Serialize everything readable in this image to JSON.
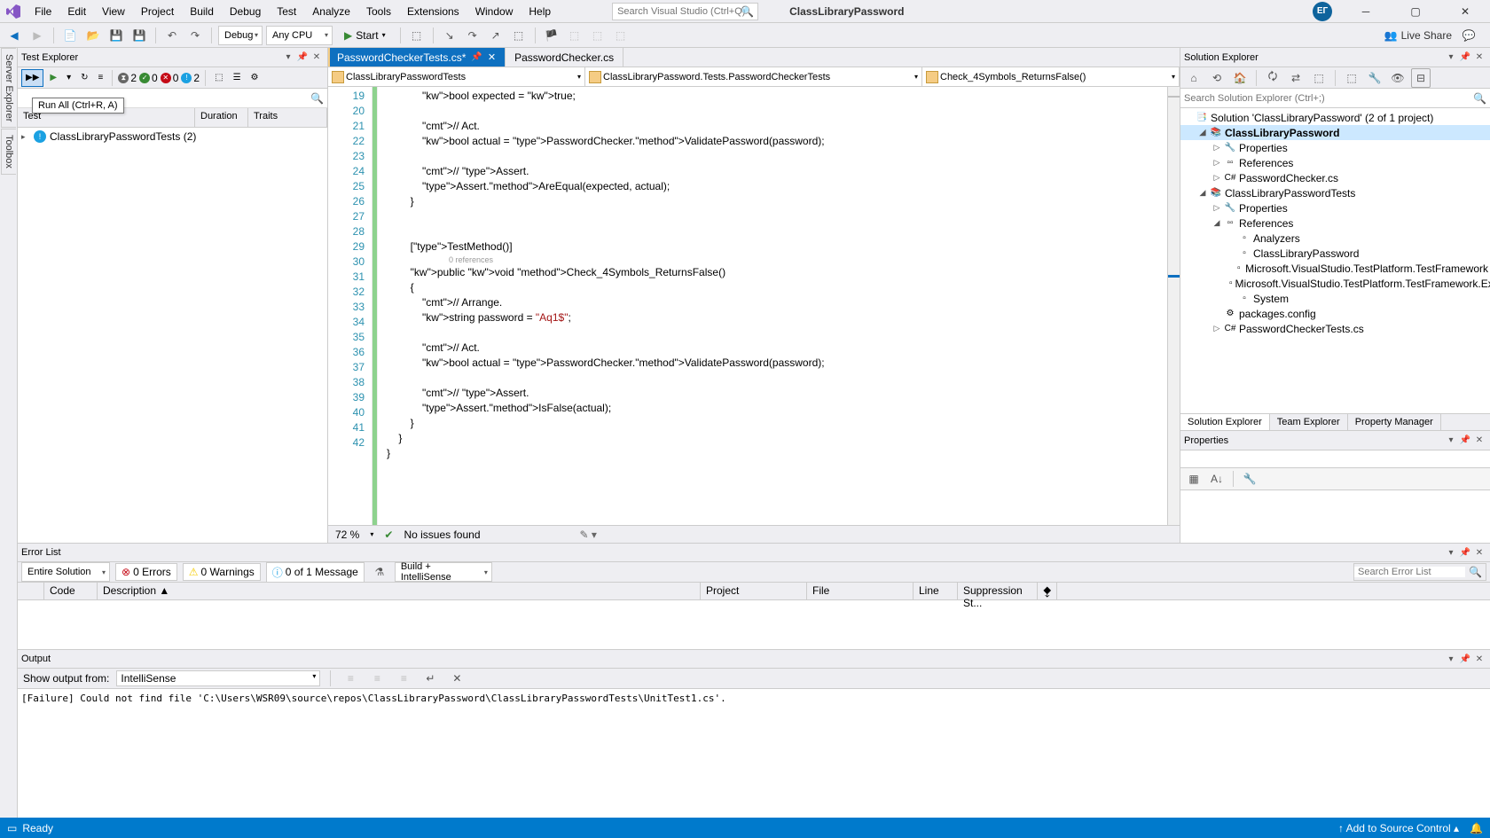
{
  "title_menu": [
    "File",
    "Edit",
    "View",
    "Project",
    "Build",
    "Debug",
    "Test",
    "Analyze",
    "Tools",
    "Extensions",
    "Window",
    "Help"
  ],
  "title_search_placeholder": "Search Visual Studio (Ctrl+Q)",
  "solution_title": "ClassLibraryPassword",
  "user_initials": "ЕГ",
  "toolbar": {
    "config": "Debug",
    "platform": "Any CPU",
    "start": "Start",
    "liveshare": "Live Share"
  },
  "left_rail": [
    "Server Explorer",
    "Toolbox"
  ],
  "test_explorer": {
    "title": "Test Explorer",
    "tooltip": "Run All (Ctrl+R, A)",
    "counts": {
      "total": "2",
      "passed": "0",
      "failed": "0",
      "notrun": "2"
    },
    "columns": [
      "Test",
      "Duration",
      "Traits"
    ],
    "root": "ClassLibraryPasswordTests (2)"
  },
  "editor": {
    "tabs": [
      {
        "name": "PasswordCheckerTests.cs*",
        "active": true
      },
      {
        "name": "PasswordChecker.cs",
        "active": false
      }
    ],
    "nav": [
      "ClassLibraryPasswordTests",
      "ClassLibraryPassword.Tests.PasswordCheckerTests",
      "Check_4Symbols_ReturnsFalse()"
    ],
    "line_start": 19,
    "line_end": 42,
    "zoom": "72 %",
    "issues": "No issues found",
    "references_hint": "0 references"
  },
  "code": [
    {
      "n": 19,
      "t": "            bool expected = true;"
    },
    {
      "n": 20,
      "t": ""
    },
    {
      "n": 21,
      "t": "            // Act."
    },
    {
      "n": 22,
      "t": "            bool actual = PasswordChecker.ValidatePassword(password);"
    },
    {
      "n": 23,
      "t": ""
    },
    {
      "n": 24,
      "t": "            // Assert."
    },
    {
      "n": 25,
      "t": "            Assert.AreEqual(expected, actual);"
    },
    {
      "n": 26,
      "t": "        }"
    },
    {
      "n": 27,
      "t": ""
    },
    {
      "n": 28,
      "t": ""
    },
    {
      "n": 29,
      "t": "        [TestMethod()]"
    },
    {
      "n": 30,
      "t": "        public void Check_4Symbols_ReturnsFalse()"
    },
    {
      "n": 31,
      "t": "        {"
    },
    {
      "n": 32,
      "t": "            // Arrange."
    },
    {
      "n": 33,
      "t": "            string password = \"Aq1$\";"
    },
    {
      "n": 34,
      "t": ""
    },
    {
      "n": 35,
      "t": "            // Act."
    },
    {
      "n": 36,
      "t": "            bool actual = PasswordChecker.ValidatePassword(password);"
    },
    {
      "n": 37,
      "t": ""
    },
    {
      "n": 38,
      "t": "            // Assert."
    },
    {
      "n": 39,
      "t": "            Assert.IsFalse(actual);"
    },
    {
      "n": 40,
      "t": "        }"
    },
    {
      "n": 41,
      "t": "    }"
    },
    {
      "n": 42,
      "t": "}"
    }
  ],
  "solution_explorer": {
    "title": "Solution Explorer",
    "search_placeholder": "Search Solution Explorer (Ctrl+;)",
    "nodes": [
      {
        "depth": 0,
        "icon": "sln",
        "label": "Solution 'ClassLibraryPassword' (2 of 1 project)",
        "exp": "-"
      },
      {
        "depth": 1,
        "icon": "proj",
        "label": "ClassLibraryPassword",
        "exp": "▾",
        "bold": true,
        "selected": true
      },
      {
        "depth": 2,
        "icon": "wrench",
        "label": "Properties",
        "exp": "▸"
      },
      {
        "depth": 2,
        "icon": "refs",
        "label": "References",
        "exp": "▸"
      },
      {
        "depth": 2,
        "icon": "cs",
        "label": "PasswordChecker.cs",
        "exp": "▸"
      },
      {
        "depth": 1,
        "icon": "proj",
        "label": "ClassLibraryPasswordTests",
        "exp": "▾"
      },
      {
        "depth": 2,
        "icon": "wrench",
        "label": "Properties",
        "exp": "▸"
      },
      {
        "depth": 2,
        "icon": "refs",
        "label": "References",
        "exp": "▾"
      },
      {
        "depth": 3,
        "icon": "ref",
        "label": "Analyzers",
        "exp": ""
      },
      {
        "depth": 3,
        "icon": "ref",
        "label": "ClassLibraryPassword",
        "exp": ""
      },
      {
        "depth": 3,
        "icon": "ref",
        "label": "Microsoft.VisualStudio.TestPlatform.TestFramework",
        "exp": ""
      },
      {
        "depth": 3,
        "icon": "ref",
        "label": "Microsoft.VisualStudio.TestPlatform.TestFramework.Extensions",
        "exp": ""
      },
      {
        "depth": 3,
        "icon": "ref",
        "label": "System",
        "exp": ""
      },
      {
        "depth": 2,
        "icon": "cfg",
        "label": "packages.config",
        "exp": ""
      },
      {
        "depth": 2,
        "icon": "cs",
        "label": "PasswordCheckerTests.cs",
        "exp": "▸"
      }
    ],
    "bottom_tabs": [
      "Solution Explorer",
      "Team Explorer",
      "Property Manager"
    ]
  },
  "properties": {
    "title": "Properties"
  },
  "error_list": {
    "title": "Error List",
    "scope": "Entire Solution",
    "errors": "0 Errors",
    "warnings": "0 Warnings",
    "messages": "0 of 1 Message",
    "build_filter": "Build + IntelliSense",
    "search_placeholder": "Search Error List",
    "columns": [
      "",
      "Code",
      "Description ▲",
      "Project",
      "File",
      "Line",
      "Suppression St..."
    ]
  },
  "output": {
    "title": "Output",
    "from_label": "Show output from:",
    "from_value": "IntelliSense",
    "text": "[Failure] Could not find file 'C:\\Users\\WSR09\\source\\repos\\ClassLibraryPassword\\ClassLibraryPasswordTests\\UnitTest1.cs'."
  },
  "status": {
    "ready": "Ready",
    "source_control": "Add to Source Control"
  }
}
